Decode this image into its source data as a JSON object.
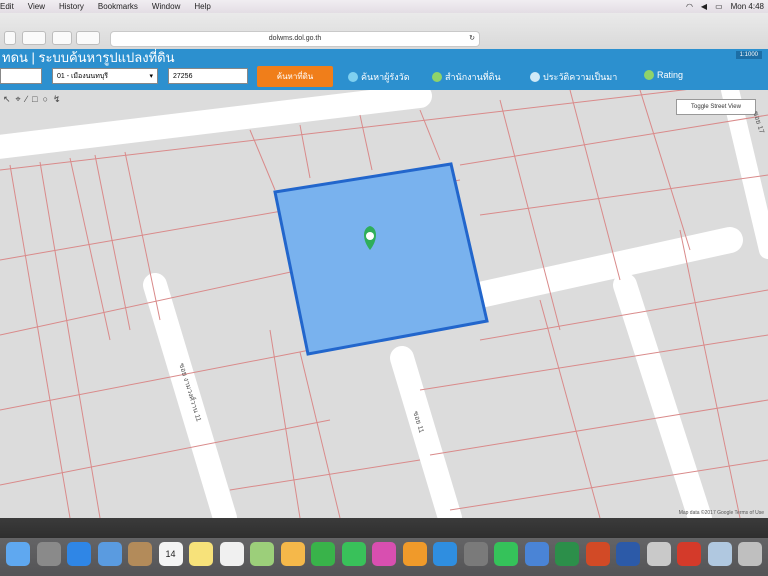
{
  "menubar": {
    "items": [
      "Edit",
      "View",
      "History",
      "Bookmarks",
      "Window",
      "Help"
    ],
    "clock": "Mon 4:48"
  },
  "browser": {
    "url": "dolwms.dol.go.th"
  },
  "header": {
    "title": "ทดน | ระบบค้นหารูปแปลงที่ดิน",
    "scale": "1:1000"
  },
  "search": {
    "district_value": "",
    "subdistrict_value": "01 - เมืองนนทบุรี",
    "parcel_value": "27256",
    "search_button": "ค้นหาที่ดิน"
  },
  "nav": {
    "link1": "ค้นหาผู้รังวัด",
    "link2": "สำนักงานที่ดิน",
    "link3": "ประวัติความเป็นมา",
    "link4": "Rating"
  },
  "map": {
    "street_view_button": "Toggle Street View",
    "attribution": "Map data ©2017 Google  Terms of Use",
    "road_label_1": "ซอย งามวงศ์วาน 11",
    "road_label_2": "ซอย 17",
    "road_label_3": "ซอย 11"
  },
  "colors": {
    "header_blue": "#2c90cf",
    "search_orange": "#f07e1a",
    "parcel_fill": "#79b2ee",
    "parcel_border": "#2266cc",
    "lot_lines": "#d98a8a"
  },
  "dock": {
    "apps": [
      "finder-icon",
      "launchpad-icon",
      "safari-icon",
      "mail-icon",
      "contacts-icon",
      "calendar-icon",
      "notes-icon",
      "reminders-icon",
      "maps-icon",
      "photos-icon",
      "messages-icon",
      "facetime-icon",
      "itunes-icon",
      "ibooks-icon",
      "app-store-icon",
      "system-preferences-icon",
      "line-icon",
      "keynote-icon",
      "excel-icon",
      "powerpoint-icon",
      "word-icon",
      "preview-icon",
      "acrobat-icon",
      "downloads-icon",
      "trash-icon"
    ],
    "calendar_date": "14"
  }
}
